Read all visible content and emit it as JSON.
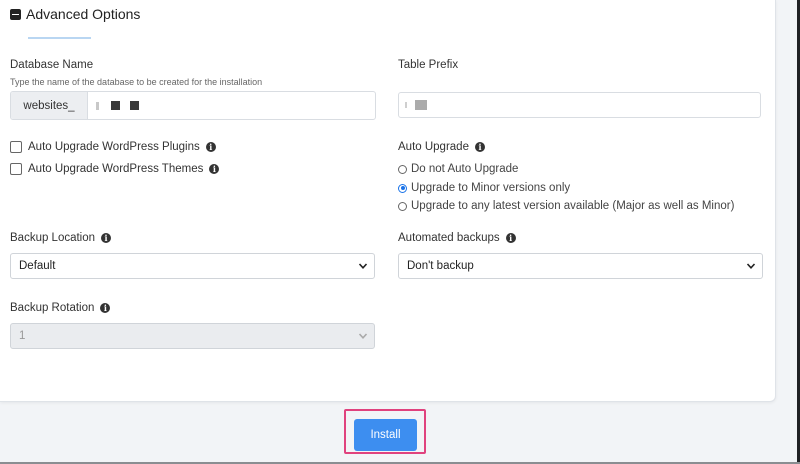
{
  "section": {
    "title": "Advanced Options"
  },
  "database": {
    "label": "Database Name",
    "help": "Type the name of the database to be created for the installation",
    "prefix_addon": "websites_",
    "value": ""
  },
  "table_prefix": {
    "label": "Table Prefix",
    "value": ""
  },
  "auto_upgrade_checkboxes": [
    {
      "label": "Auto Upgrade WordPress Plugins",
      "checked": false
    },
    {
      "label": "Auto Upgrade WordPress Themes",
      "checked": false
    }
  ],
  "auto_upgrade": {
    "label": "Auto Upgrade",
    "options": [
      {
        "label": "Do not Auto Upgrade",
        "selected": false
      },
      {
        "label": "Upgrade to Minor versions only",
        "selected": true
      },
      {
        "label": "Upgrade to any latest version available (Major as well as Minor)",
        "selected": false
      }
    ]
  },
  "backup_location": {
    "label": "Backup Location",
    "selected": "Default"
  },
  "automated_backups": {
    "label": "Automated backups",
    "selected": "Don't backup"
  },
  "backup_rotation": {
    "label": "Backup Rotation",
    "selected": "1",
    "disabled": true
  },
  "actions": {
    "install_label": "Install"
  },
  "colors": {
    "accent": "#3d8ef0",
    "highlight": "#e0427e",
    "radio_selected": "#1a73e8"
  },
  "icons": {
    "collapse": "minus-square-icon",
    "info": "info-circle-icon",
    "dropdown": "chevron-down-icon"
  }
}
